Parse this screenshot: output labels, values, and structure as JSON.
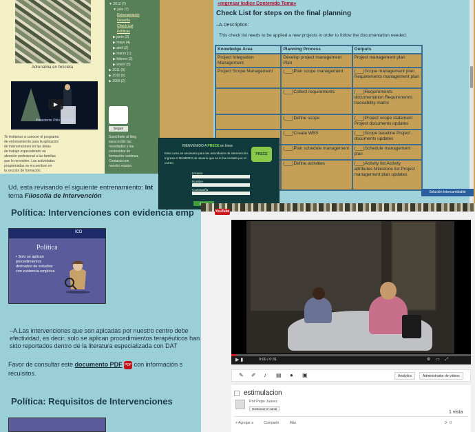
{
  "blog": {
    "photo_caption": "Adrenalina en bicicleta",
    "video_caption": "Presidente Pitín Sánchez",
    "text_lines": [
      "Te invitamos a conocer el programa",
      "de entrenamiento para la aplicación",
      "de intervenciones en las áreas",
      "de trabajo especializado en",
      "atención profesional a las familias",
      "que lo necesiten. Las actividades",
      "programadas se encuentran en",
      "la sección de formación."
    ]
  },
  "sidebar": {
    "archive": [
      {
        "label": "▼ 2012 (7)",
        "level": 0
      },
      {
        "label": "▼ julio (7)",
        "level": 1
      },
      {
        "label": "Entrenamiento",
        "level": 2
      },
      {
        "label": "Filosofía",
        "level": 2
      },
      {
        "label": "Check List",
        "level": 2
      },
      {
        "label": "Políticas",
        "level": 2
      },
      {
        "label": "▶ junio (3)",
        "level": 1
      },
      {
        "label": "▶ mayo (4)",
        "level": 1
      },
      {
        "label": "▶ abril (2)",
        "level": 1
      },
      {
        "label": "▶ marzo (1)",
        "level": 1
      },
      {
        "label": "▶ febrero (2)",
        "level": 1
      },
      {
        "label": "▶ enero (5)",
        "level": 1
      },
      {
        "label": "▶ 2011 (9)",
        "level": 0
      },
      {
        "label": "▶ 2010 (6)",
        "level": 0
      },
      {
        "label": "▶ 2009 (2)",
        "level": 0
      }
    ],
    "button_label": "Seguir",
    "text_lines": [
      "Suscríbete al blog",
      "para recibir las",
      "novedades y los",
      "contenidos de",
      "formación continua.",
      "Contacta con",
      "nuestro equipo."
    ]
  },
  "checklist": {
    "back_link": "«regresar Indice Contenido Tema»",
    "title": "Check List for steps on the final planning",
    "section": "–A.Description:",
    "description": "This check list needs to be applied a new projects in order to follow the documentation needed.",
    "headers": [
      "Knowledge Area",
      "Planning Process",
      "Outputs"
    ],
    "rows": [
      [
        "Project Integration Management",
        "Develop project management Plan",
        "Project management plan"
      ],
      [
        "Project Scope Management",
        "(___)Plan scope management",
        "(___)Scope management plan Requirements management plan"
      ],
      [
        "",
        "(___)Collect requirements",
        "(___)Requirements documentation Requirements traceability matrix"
      ],
      [
        "",
        "(___)Define scope",
        "(___)Project scope statement Project documents updates"
      ],
      [
        "",
        "(___)Create WBS",
        "(___)Scope baseline Project documents updates"
      ],
      [
        "",
        "(___)Plan schedule management",
        "(___)Schedule management plan"
      ],
      [
        "",
        "(___)Define activities",
        "(___)Activity list Activity attributes Milestone list Project management plan updates"
      ]
    ],
    "footer_button": "Solución Intercambiable"
  },
  "training": {
    "intro_prefix": "Ud. esta revisando el siguiente entrenamiento: ",
    "intro_bold": "Int",
    "intro_line2_prefix": "tema ",
    "intro_line2_italic": "Filosofía de Intervención",
    "heading1": "Política: Intervenciones con evidencia emp",
    "slide_brand": "ICD",
    "slide_title": "Política",
    "slide_bullet": "• Solo se aplican procedimientos derivados de estudios con evidencia empírica",
    "paragraph1": "–A.Las intervenciones que son apicadas por nuestro centro debe efectividad, es decir, solo se aplican procedimientos terapéuticos han sido reportados dentro de la literatura especializada con DAT",
    "paragraph2_prefix": "Favor de consultar este ",
    "pdf_link": "documento PDF",
    "pdf_icon": "PDF",
    "paragraph2_suffix": " con información s recuisitos.",
    "heading2": "Política: Requisitos de Intervenciones"
  },
  "login": {
    "title_prefix": "BIENVENIDO A ",
    "title_brand": "PRECE",
    "title_suffix": " en línea",
    "logo": "PRECE",
    "desc": "Este curso es necesario para las actividades de intervención. Ingrese el NÚMERO de usuario que se le ha enviado por el correo.",
    "fields": [
      "Usuario",
      "Nombre",
      "Contraseña"
    ],
    "login_button": "Entrar"
  },
  "video": {
    "site_logo": "YouTube",
    "title": "estimulacion",
    "channel": "Por Pepe Juárez",
    "channel_button": "Gestionar el canal",
    "views": "1 vista",
    "time": "0:00 / 0:31",
    "progress": 0.02,
    "tool_buttons": [
      "Analytics",
      "Administrador de videos"
    ],
    "actions": [
      "+ Agregar a",
      "Compartir",
      "Más"
    ],
    "likes": "0 · 0"
  }
}
